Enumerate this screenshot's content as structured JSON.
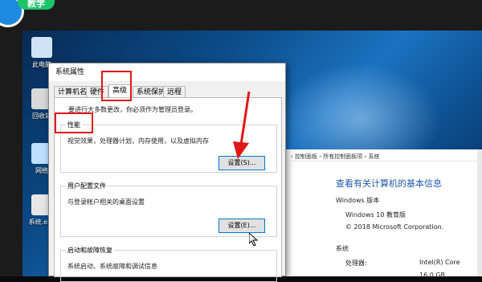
{
  "tutorial_badge": "教学",
  "desktop_icons": [
    {
      "label": "此电脑",
      "icon": "computer-icon",
      "color": "#cfe3f7"
    },
    {
      "label": "回收站",
      "icon": "recycle-bin-icon",
      "color": "#d8d8d8"
    },
    {
      "label": "网络",
      "icon": "network-icon",
      "color": "#bfe0ff"
    },
    {
      "label": "系统.exe",
      "icon": "app-icon",
      "color": "#e6e6e6"
    }
  ],
  "dialog": {
    "title": "系统属性",
    "tabs": [
      "计算机名",
      "硬件",
      "高级",
      "系统保护",
      "远程"
    ],
    "active_tab": "高级",
    "admin_note": "要进行大多数更改，你必须作为管理员登录。",
    "performance": {
      "title": "性能",
      "description": "视觉效果，处理器计划，内存使用，以及虚拟内存",
      "button": "设置(S)..."
    },
    "user_profiles": {
      "title": "用户配置文件",
      "description": "与登录帐户相关的桌面设置",
      "button": "设置(E)..."
    },
    "startup_recovery": {
      "title": "启动和故障恢复",
      "description": "系统启动、系统故障和调试信息"
    }
  },
  "control_panel": {
    "breadcrumb": "› 控制面板 › 所有控制面板项 › 系统",
    "heading": "查看有关计算机的基本信息",
    "windows_edition_label": "Windows 版本",
    "edition": "Windows 10 教育版",
    "copyright": "© 2018 Microsoft Corporation.",
    "system_label": "系统",
    "processor_label": "处理器:",
    "processor_value": "Intel(R) Core",
    "ram_value": "16.0 GB"
  },
  "colors": {
    "highlight_red": "#e01818",
    "accent_blue": "#0078d7"
  }
}
